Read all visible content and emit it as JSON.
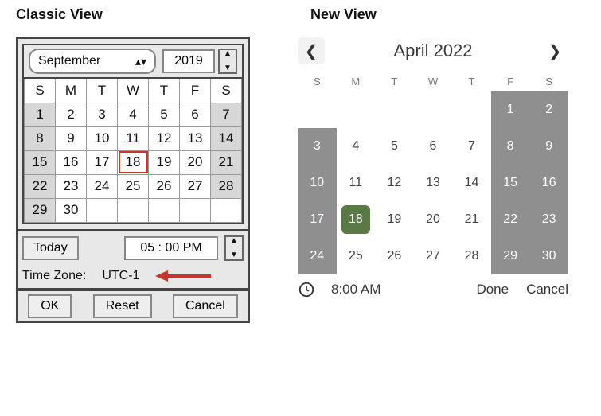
{
  "headings": {
    "classic": "Classic View",
    "new_": "New View"
  },
  "classic": {
    "month": "September",
    "year": "2019",
    "weekdays": [
      "S",
      "M",
      "T",
      "W",
      "T",
      "F",
      "S"
    ],
    "grid": [
      [
        {
          "n": 1,
          "weekend": true
        },
        {
          "n": 2
        },
        {
          "n": 3
        },
        {
          "n": 4
        },
        {
          "n": 5
        },
        {
          "n": 6
        },
        {
          "n": 7,
          "weekend": true
        }
      ],
      [
        {
          "n": 8,
          "weekend": true
        },
        {
          "n": 9
        },
        {
          "n": 10
        },
        {
          "n": 11
        },
        {
          "n": 12
        },
        {
          "n": 13
        },
        {
          "n": 14,
          "weekend": true
        }
      ],
      [
        {
          "n": 15,
          "weekend": true
        },
        {
          "n": 16
        },
        {
          "n": 17
        },
        {
          "n": 18,
          "selected": true
        },
        {
          "n": 19
        },
        {
          "n": 20
        },
        {
          "n": 21,
          "weekend": true
        }
      ],
      [
        {
          "n": 22,
          "weekend": true
        },
        {
          "n": 23
        },
        {
          "n": 24
        },
        {
          "n": 25
        },
        {
          "n": 26
        },
        {
          "n": 27
        },
        {
          "n": 28,
          "weekend": true
        }
      ],
      [
        {
          "n": 29,
          "weekend": true
        },
        {
          "n": 30
        },
        {
          "n": null
        },
        {
          "n": null
        },
        {
          "n": null
        },
        {
          "n": null
        },
        {
          "n": null
        }
      ]
    ],
    "today_label": "Today",
    "time_value": "05 : 00 PM",
    "tz_label": "Time Zone:",
    "tz_value": "UTC-1",
    "buttons": {
      "ok": "OK",
      "reset": "Reset",
      "cancel": "Cancel"
    }
  },
  "newview": {
    "title": "April 2022",
    "weekdays": [
      "S",
      "M",
      "T",
      "W",
      "T",
      "F",
      "S"
    ],
    "grid": [
      [
        {
          "n": null
        },
        {
          "n": null
        },
        {
          "n": null
        },
        {
          "n": null
        },
        {
          "n": null
        },
        {
          "n": 1,
          "weekend": true
        },
        {
          "n": 2,
          "weekend": true
        }
      ],
      [
        {
          "n": 3,
          "weekend": true
        },
        {
          "n": 4
        },
        {
          "n": 5
        },
        {
          "n": 6
        },
        {
          "n": 7
        },
        {
          "n": 8,
          "weekend": true
        },
        {
          "n": 9,
          "weekend": true
        }
      ],
      [
        {
          "n": 10,
          "weekend": true
        },
        {
          "n": 11
        },
        {
          "n": 12
        },
        {
          "n": 13
        },
        {
          "n": 14
        },
        {
          "n": 15,
          "weekend": true
        },
        {
          "n": 16,
          "weekend": true
        }
      ],
      [
        {
          "n": 17,
          "weekend": true
        },
        {
          "n": 18,
          "selected": true
        },
        {
          "n": 19
        },
        {
          "n": 20
        },
        {
          "n": 21
        },
        {
          "n": 22,
          "weekend": true
        },
        {
          "n": 23,
          "weekend": true
        }
      ],
      [
        {
          "n": 24,
          "weekend": true
        },
        {
          "n": 25
        },
        {
          "n": 26
        },
        {
          "n": 27
        },
        {
          "n": 28
        },
        {
          "n": 29,
          "weekend": true
        },
        {
          "n": 30,
          "weekend": true
        }
      ]
    ],
    "time_value": "8:00 AM",
    "buttons": {
      "done": "Done",
      "cancel": "Cancel"
    }
  }
}
